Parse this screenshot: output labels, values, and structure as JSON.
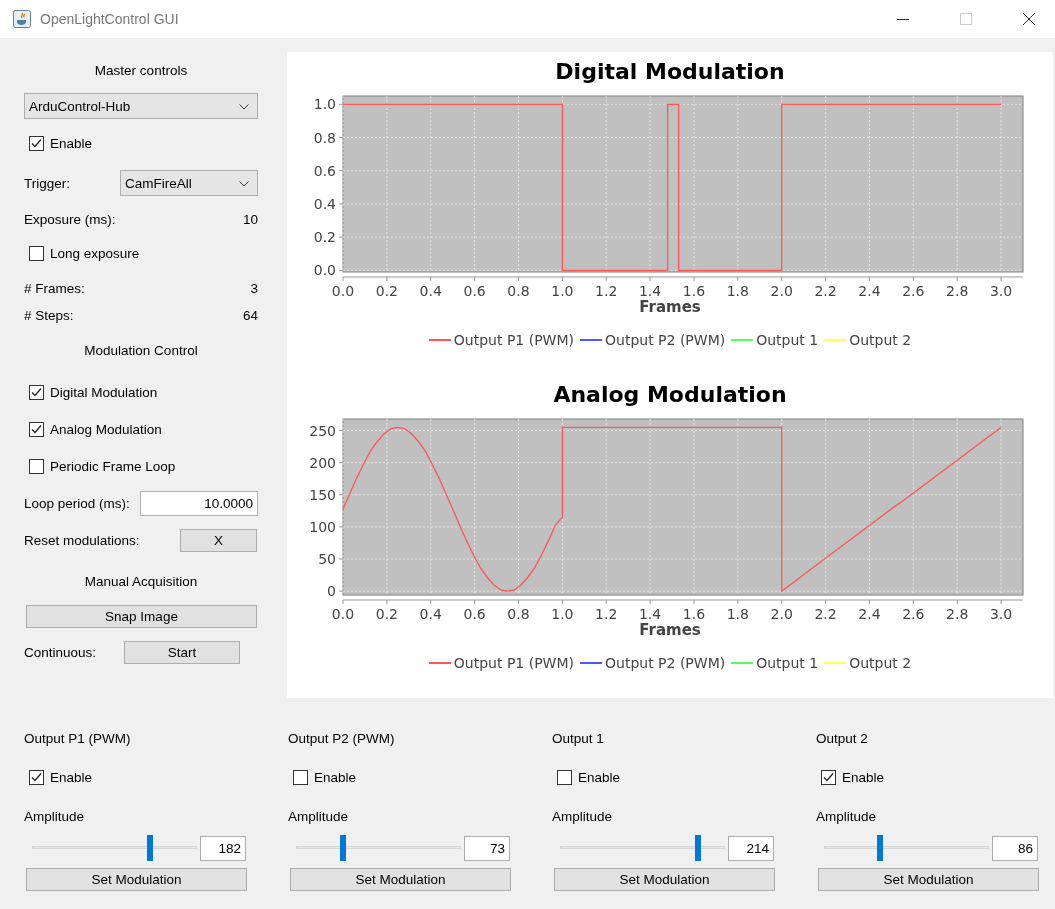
{
  "window": {
    "title": "OpenLightControl GUI"
  },
  "master": {
    "heading": "Master controls",
    "device": "ArduControl-Hub",
    "enable": {
      "label": "Enable",
      "checked": true
    },
    "trigger": {
      "label": "Trigger:",
      "value": "CamFireAll"
    },
    "exposure": {
      "label": "Exposure (ms):",
      "value": "10"
    },
    "long_exposure": {
      "label": "Long exposure",
      "checked": false
    },
    "frames": {
      "label": "# Frames:",
      "value": "3"
    },
    "steps": {
      "label": "# Steps:",
      "value": "64"
    }
  },
  "modulation_control": {
    "heading": "Modulation Control",
    "options": [
      {
        "label": "Digital Modulation",
        "checked": true
      },
      {
        "label": "Analog Modulation",
        "checked": true
      },
      {
        "label": "Periodic Frame Loop",
        "checked": false
      }
    ],
    "loop_period": {
      "label": "Loop period (ms):",
      "value": "10.0000"
    },
    "reset": {
      "label": "Reset modulations:",
      "button": "X"
    }
  },
  "manual_acquisition": {
    "heading": "Manual Acquisition",
    "snap_button": "Snap Image",
    "continuous": {
      "label": "Continuous:",
      "button": "Start"
    }
  },
  "charts": [
    {
      "chart_data": {
        "type": "line",
        "title": "Digital Modulation",
        "xlabel": "Frames",
        "grid": true,
        "xlim": [
          0,
          3.1
        ],
        "ylim": [
          -0.01,
          1.05
        ],
        "xticks": [
          {
            "value": 0,
            "label": "0.0"
          },
          {
            "value": 0.2,
            "label": "0.2"
          },
          {
            "value": 0.4,
            "label": "0.4"
          },
          {
            "value": 0.6,
            "label": "0.6"
          },
          {
            "value": 0.8,
            "label": "0.8"
          },
          {
            "value": 1,
            "label": "1.0"
          },
          {
            "value": 1.2,
            "label": "1.2"
          },
          {
            "value": 1.4,
            "label": "1.4"
          },
          {
            "value": 1.6,
            "label": "1.6"
          },
          {
            "value": 1.8,
            "label": "1.8"
          },
          {
            "value": 2,
            "label": "2.0"
          },
          {
            "value": 2.2,
            "label": "2.2"
          },
          {
            "value": 2.4,
            "label": "2.4"
          },
          {
            "value": 2.6,
            "label": "2.6"
          },
          {
            "value": 2.8,
            "label": "2.8"
          },
          {
            "value": 3,
            "label": "3.0"
          }
        ],
        "yticks": [
          {
            "value": 0,
            "label": "0.0"
          },
          {
            "value": 0.2,
            "label": "0.2"
          },
          {
            "value": 0.4,
            "label": "0.4"
          },
          {
            "value": 0.6,
            "label": "0.6"
          },
          {
            "value": 0.8,
            "label": "0.8"
          },
          {
            "value": 1,
            "label": "1.0"
          }
        ],
        "x": [
          0,
          1,
          1,
          1.48,
          1.48,
          1.53,
          1.53,
          2,
          2,
          3
        ],
        "series": [
          {
            "name": "Output P1 (PWM)",
            "color": "#ff5555",
            "values": [
              1,
              1,
              0,
              0,
              1,
              1,
              0,
              0,
              1,
              1
            ]
          },
          {
            "name": "Output P2 (PWM)",
            "color": "#5555ff",
            "values": [
              null,
              null,
              null,
              null,
              null,
              null,
              null,
              null,
              null,
              null
            ]
          },
          {
            "name": "Output 1",
            "color": "#55ff55",
            "values": [
              null,
              null,
              null,
              null,
              null,
              null,
              null,
              null,
              null,
              null
            ]
          },
          {
            "name": "Output 2",
            "color": "#ffff55",
            "values": [
              null,
              null,
              null,
              null,
              null,
              null,
              null,
              null,
              null,
              null
            ]
          }
        ]
      }
    },
    {
      "chart_data": {
        "type": "line",
        "title": "Analog Modulation",
        "xlabel": "Frames",
        "grid": true,
        "xlim": [
          0,
          3.1
        ],
        "ylim": [
          -6,
          268
        ],
        "xticks": [
          {
            "value": 0,
            "label": "0.0"
          },
          {
            "value": 0.2,
            "label": "0.2"
          },
          {
            "value": 0.4,
            "label": "0.4"
          },
          {
            "value": 0.6,
            "label": "0.6"
          },
          {
            "value": 0.8,
            "label": "0.8"
          },
          {
            "value": 1,
            "label": "1.0"
          },
          {
            "value": 1.2,
            "label": "1.2"
          },
          {
            "value": 1.4,
            "label": "1.4"
          },
          {
            "value": 1.6,
            "label": "1.6"
          },
          {
            "value": 1.8,
            "label": "1.8"
          },
          {
            "value": 2,
            "label": "2.0"
          },
          {
            "value": 2.2,
            "label": "2.2"
          },
          {
            "value": 2.4,
            "label": "2.4"
          },
          {
            "value": 2.6,
            "label": "2.6"
          },
          {
            "value": 2.8,
            "label": "2.8"
          },
          {
            "value": 3,
            "label": "3.0"
          }
        ],
        "yticks": [
          0,
          50,
          100,
          150,
          200,
          250
        ],
        "x": [
          0,
          0.03125,
          0.0625,
          0.09375,
          0.125,
          0.15625,
          0.1875,
          0.21875,
          0.25,
          0.28125,
          0.3125,
          0.34375,
          0.375,
          0.40625,
          0.4375,
          0.46875,
          0.5,
          0.53125,
          0.5625,
          0.59375,
          0.625,
          0.65625,
          0.6875,
          0.71875,
          0.75,
          0.78125,
          0.8125,
          0.84375,
          0.875,
          0.90625,
          0.9375,
          0.96875,
          1,
          1,
          2,
          2,
          2.0625,
          2.125,
          2.1875,
          2.25,
          2.3125,
          2.375,
          2.4375,
          2.5,
          2.5625,
          2.625,
          2.6875,
          2.75,
          2.8125,
          2.875,
          2.9375,
          3
        ],
        "series": [
          {
            "name": "Output P1 (PWM)",
            "color": "#ff5555",
            "values": [
              128,
              152,
              176,
              198,
              218,
              233,
              245,
              253,
              255,
              253,
              245,
              233,
              218,
              198,
              176,
              152,
              128,
              103,
              79,
              57,
              37,
              22,
              10,
              2,
              0,
              2,
              10,
              22,
              37,
              57,
              79,
              103,
              115,
              255,
              255,
              0,
              16,
              32,
              48,
              64,
              80,
              96,
              112,
              128,
              143,
              159,
              175,
              191,
              207,
              223,
              239,
              255
            ]
          },
          {
            "name": "Output P2 (PWM)",
            "color": "#5555ff",
            "values": [
              null,
              null,
              null,
              null,
              null,
              null,
              null,
              null,
              null,
              null,
              null,
              null,
              null,
              null,
              null,
              null,
              null,
              null,
              null,
              null,
              null,
              null,
              null,
              null,
              null,
              null,
              null,
              null,
              null,
              null,
              null,
              null,
              null,
              null,
              null,
              null,
              null,
              null,
              null,
              null,
              null,
              null,
              null,
              null,
              null,
              null,
              null,
              null,
              null,
              null,
              null,
              null
            ]
          },
          {
            "name": "Output 1",
            "color": "#55ff55",
            "values": [
              null,
              null,
              null,
              null,
              null,
              null,
              null,
              null,
              null,
              null,
              null,
              null,
              null,
              null,
              null,
              null,
              null,
              null,
              null,
              null,
              null,
              null,
              null,
              null,
              null,
              null,
              null,
              null,
              null,
              null,
              null,
              null,
              null,
              null,
              null,
              null,
              null,
              null,
              null,
              null,
              null,
              null,
              null,
              null,
              null,
              null,
              null,
              null,
              null,
              null,
              null,
              null
            ]
          },
          {
            "name": "Output 2",
            "color": "#ffff55",
            "values": [
              null,
              null,
              null,
              null,
              null,
              null,
              null,
              null,
              null,
              null,
              null,
              null,
              null,
              null,
              null,
              null,
              null,
              null,
              null,
              null,
              null,
              null,
              null,
              null,
              null,
              null,
              null,
              null,
              null,
              null,
              null,
              null,
              null,
              null,
              null,
              null,
              null,
              null,
              null,
              null,
              null,
              null,
              null,
              null,
              null,
              null,
              null,
              null,
              null,
              null,
              null,
              null
            ]
          }
        ]
      }
    }
  ],
  "outputs": [
    {
      "name": "Output P1 (PWM)",
      "enable": {
        "label": "Enable",
        "checked": true
      },
      "amplitude_label": "Amplitude",
      "level": 0.714,
      "value": "182",
      "button": "Set Modulation"
    },
    {
      "name": "Output P2 (PWM)",
      "enable": {
        "label": "Enable",
        "checked": false
      },
      "amplitude_label": "Amplitude",
      "level": 0.286,
      "value": "73",
      "button": "Set Modulation"
    },
    {
      "name": "Output 1",
      "enable": {
        "label": "Enable",
        "checked": false
      },
      "amplitude_label": "Amplitude",
      "level": 0.839,
      "value": "214",
      "button": "Set Modulation"
    },
    {
      "name": "Output 2",
      "enable": {
        "label": "Enable",
        "checked": true
      },
      "amplitude_label": "Amplitude",
      "level": 0.337,
      "value": "86",
      "button": "Set Modulation"
    }
  ]
}
